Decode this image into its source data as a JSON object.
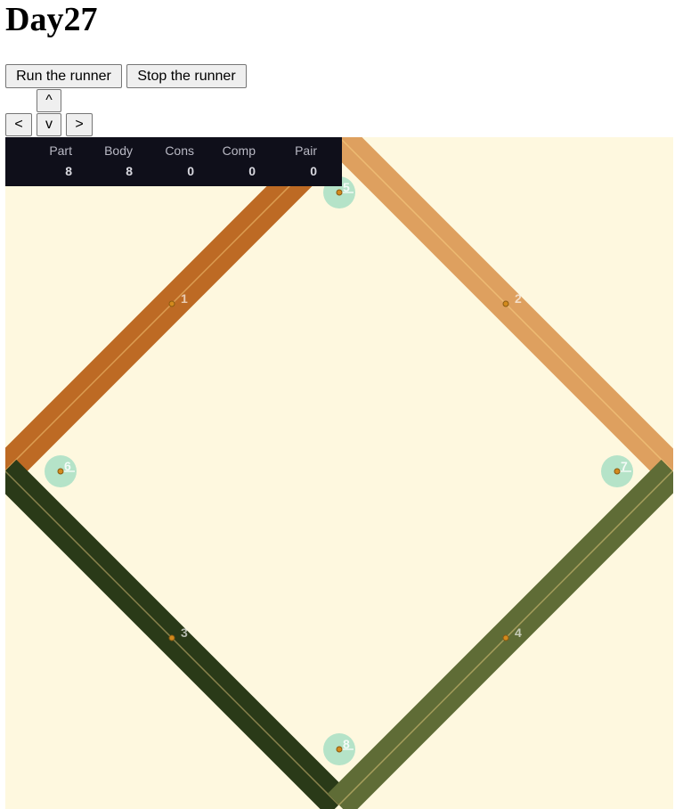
{
  "page": {
    "title": "Day27"
  },
  "controls": {
    "run_label": "Run the runner",
    "stop_label": "Stop the runner",
    "up_label": "^",
    "left_label": "<",
    "down_label": "v",
    "right_label": ">"
  },
  "stats": [
    {
      "label": "Part",
      "value": "8"
    },
    {
      "label": "Body",
      "value": "8"
    },
    {
      "label": "Cons",
      "value": "0"
    },
    {
      "label": "Comp",
      "value": "0"
    },
    {
      "label": "Pair",
      "value": "0"
    }
  ],
  "scene": {
    "background": "#fef8df",
    "walls": [
      {
        "label": "1",
        "color": "#bd6a24"
      },
      {
        "label": "2",
        "color": "#dea05f"
      },
      {
        "label": "3",
        "color": "#2a3a18"
      },
      {
        "label": "4",
        "color": "#5f6c36"
      }
    ],
    "circles": [
      {
        "label": "5",
        "color": "#a8dfc4"
      },
      {
        "label": "6",
        "color": "#a8dfc4"
      },
      {
        "label": "7",
        "color": "#a8dfc4"
      },
      {
        "label": "8",
        "color": "#a8dfc4"
      }
    ]
  }
}
